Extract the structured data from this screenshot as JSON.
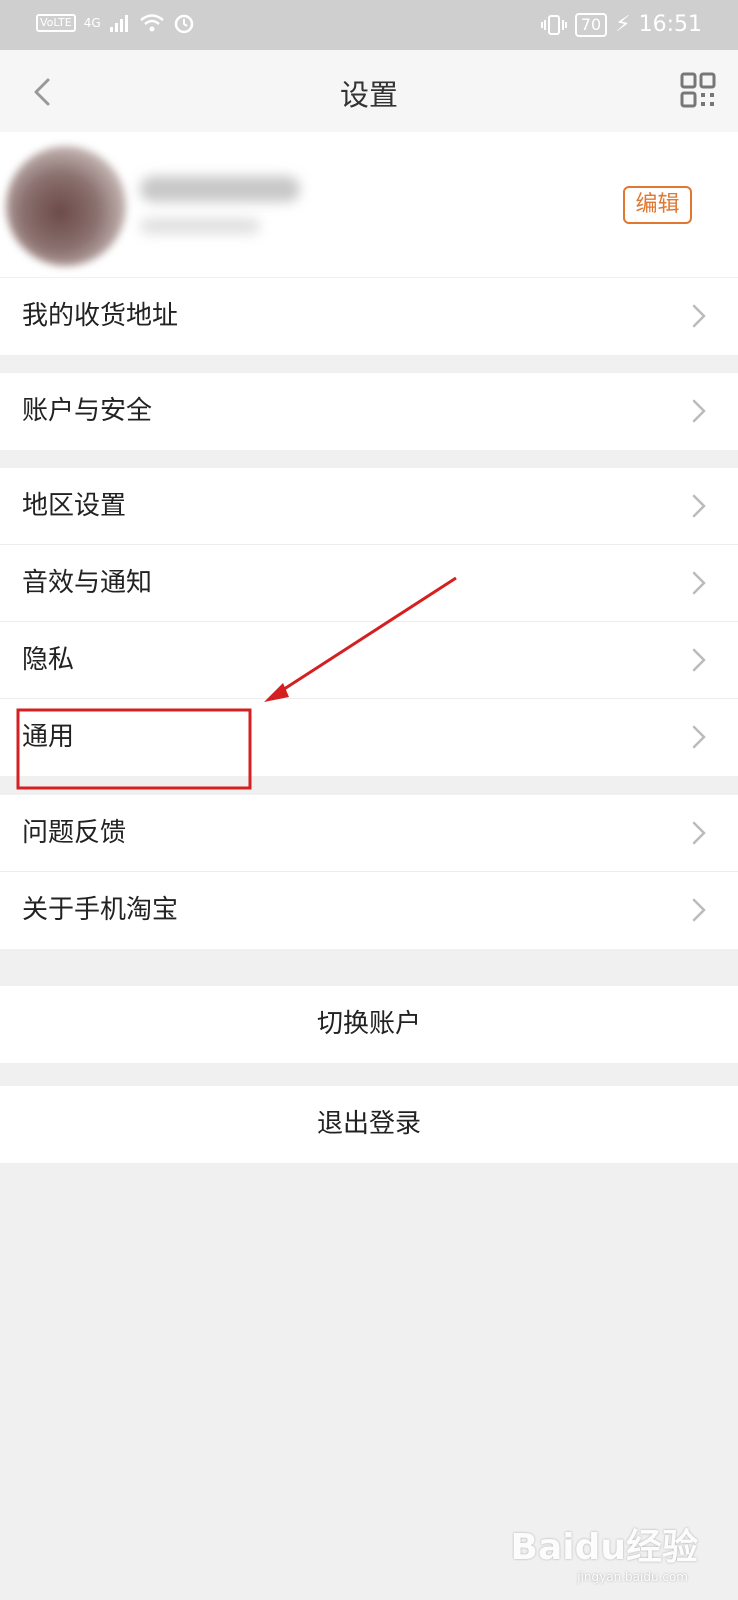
{
  "status_bar": {
    "carrier_badge": "VoLTE",
    "network": "4G",
    "battery": "70",
    "time": "16:51"
  },
  "header": {
    "title": "设置"
  },
  "profile": {
    "edit_label": "编辑"
  },
  "groups": [
    {
      "items": [
        {
          "label": "我的收货地址"
        }
      ]
    },
    {
      "items": [
        {
          "label": "账户与安全"
        }
      ]
    },
    {
      "items": [
        {
          "label": "地区设置"
        },
        {
          "label": "音效与通知"
        },
        {
          "label": "隐私"
        },
        {
          "label": "通用"
        }
      ]
    },
    {
      "items": [
        {
          "label": "问题反馈"
        },
        {
          "label": "关于手机淘宝"
        }
      ]
    }
  ],
  "actions": {
    "switch_account": "切换账户",
    "logout": "退出登录"
  },
  "annotation": {
    "color": "#d42020"
  },
  "watermark": {
    "text": "Baidu经验",
    "sub": "jingyan.baidu.com"
  }
}
